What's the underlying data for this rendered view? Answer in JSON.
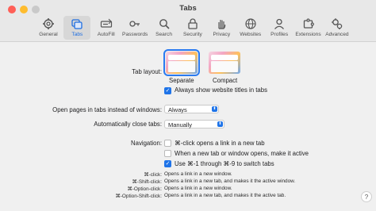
{
  "window": {
    "title": "Tabs"
  },
  "toolbar": {
    "items": [
      {
        "label": "General",
        "icon": "gear-icon"
      },
      {
        "label": "Tabs",
        "icon": "tabs-icon"
      },
      {
        "label": "AutoFill",
        "icon": "autofill-icon"
      },
      {
        "label": "Passwords",
        "icon": "key-icon"
      },
      {
        "label": "Search",
        "icon": "search-icon"
      },
      {
        "label": "Security",
        "icon": "lock-icon"
      },
      {
        "label": "Privacy",
        "icon": "hand-icon"
      },
      {
        "label": "Websites",
        "icon": "globe-icon"
      },
      {
        "label": "Profiles",
        "icon": "person-icon"
      },
      {
        "label": "Extensions",
        "icon": "puzzle-icon"
      },
      {
        "label": "Advanced",
        "icon": "gears-icon"
      }
    ],
    "selected": "Tabs"
  },
  "settings": {
    "tab_layout": {
      "label": "Tab layout:",
      "option1": "Separate",
      "option2": "Compact",
      "selected": "Separate"
    },
    "show_titles": {
      "label": "Always show website titles in tabs",
      "checked": true
    },
    "open_pages": {
      "label": "Open pages in tabs instead of windows:",
      "value": "Always"
    },
    "auto_close": {
      "label": "Automatically close tabs:",
      "value": "Manually"
    },
    "navigation": {
      "label": "Navigation:",
      "opt1": "⌘-click opens a link in a new tab",
      "opt2": "When a new tab or window opens, make it active",
      "opt3": "Use ⌘-1 through ⌘-9 to switch tabs"
    }
  },
  "shortcuts": [
    {
      "key": "⌘-click:",
      "desc": "Opens a link in a new window."
    },
    {
      "key": "⌘-Shift-click:",
      "desc": "Opens a link in a new tab, and makes it the active window."
    },
    {
      "key": "⌘-Option-click:",
      "desc": "Opens a link in a new window."
    },
    {
      "key": "⌘-Option-Shift-click:",
      "desc": "Opens a link in a new tab, and makes it the active tab."
    }
  ],
  "help": {
    "label": "?"
  },
  "colors": {
    "accent": "#1f74e8",
    "close": "#ff5f57",
    "minimize": "#febc2e"
  }
}
